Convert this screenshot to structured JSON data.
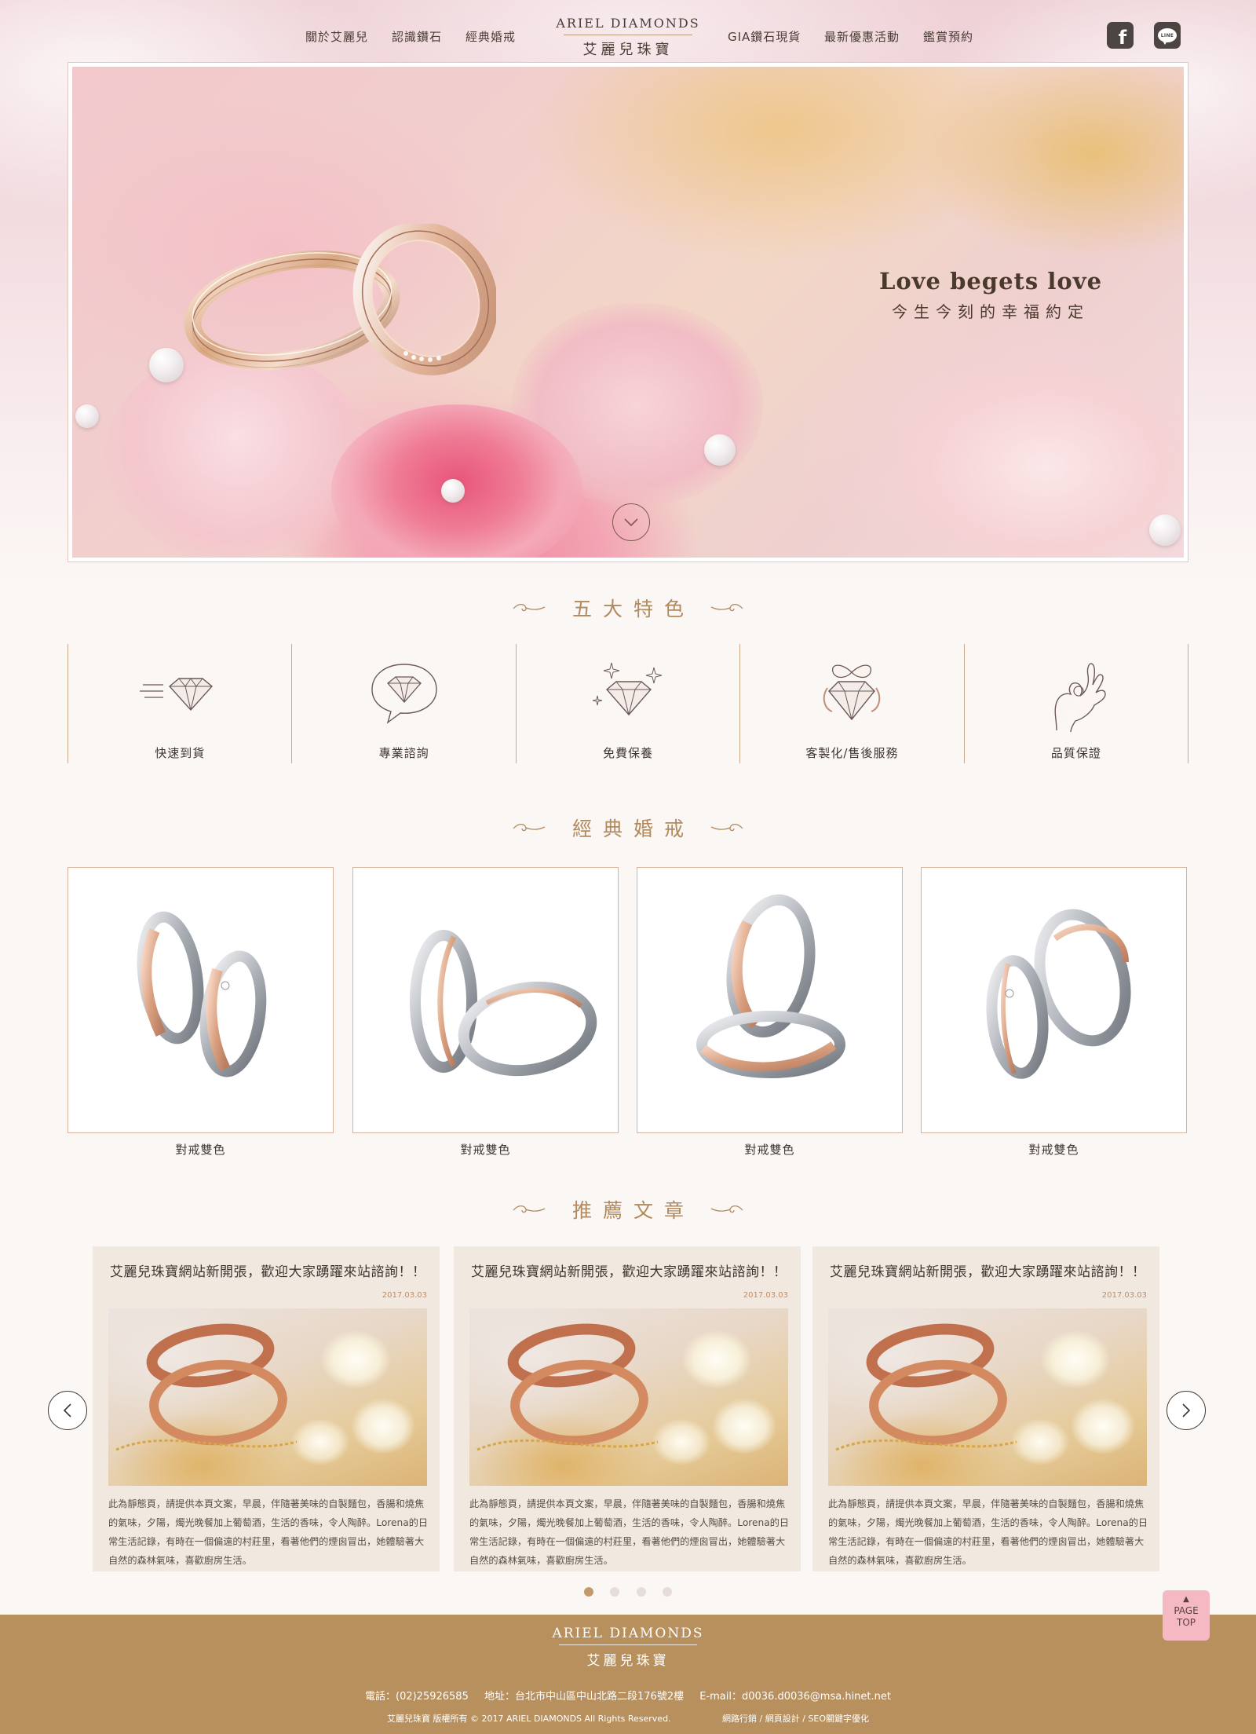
{
  "nav": {
    "left": [
      "關於艾麗兒",
      "認識鑽石",
      "經典婚戒"
    ],
    "right": [
      "GIA鑽石現貨",
      "最新優惠活動",
      "鑑賞預約"
    ],
    "logo_en": "ARIEL DIAMONDS",
    "logo_zh": "艾麗兒珠寶",
    "social": [
      {
        "name": "facebook",
        "icon": "facebook-icon",
        "glyph": "f"
      },
      {
        "name": "line",
        "icon": "line-icon",
        "glyph": "LINE"
      }
    ]
  },
  "hero": {
    "title": "Love begets love",
    "subtitle": "今生今刻的幸福約定"
  },
  "sections": {
    "features_title": "五大特色",
    "rings_title": "經典婚戒",
    "articles_title": "推薦文章"
  },
  "features": [
    {
      "label": "快速到貨",
      "icon": "fast-diamond-icon"
    },
    {
      "label": "專業諮詢",
      "icon": "diamond-speech-bubble-icon"
    },
    {
      "label": "免費保養",
      "icon": "sparkling-diamond-icon"
    },
    {
      "label": "客製化/售後服務",
      "icon": "diamond-gift-bow-icon"
    },
    {
      "label": "品質保證",
      "icon": "ok-hand-icon"
    }
  ],
  "rings": [
    {
      "label": "對戒雙色"
    },
    {
      "label": "對戒雙色"
    },
    {
      "label": "對戒雙色"
    },
    {
      "label": "對戒雙色"
    }
  ],
  "articles": [
    {
      "title": "艾麗兒珠寶網站新開張，歡迎大家踴躍來站諮詢！！",
      "date": "2017.03.03",
      "body": "此為靜態頁，請提供本頁文案，早晨，伴隨著美味的自製麵包，香腸和燒焦的氣味，夕陽，燭光晚餐加上葡萄酒，生活的香味，令人陶醉。Lorena的日常生活記錄，有時在一個偏遠的村莊里，看著他們的煙囪冒出，她體驗著大自然的森林氣味，喜歡廚房生活。"
    },
    {
      "title": "艾麗兒珠寶網站新開張，歡迎大家踴躍來站諮詢！！",
      "date": "2017.03.03",
      "body": "此為靜態頁，請提供本頁文案，早晨，伴隨著美味的自製麵包，香腸和燒焦的氣味，夕陽，燭光晚餐加上葡萄酒，生活的香味，令人陶醉。Lorena的日常生活記錄，有時在一個偏遠的村莊里，看著他們的煙囪冒出，她體驗著大自然的森林氣味，喜歡廚房生活。"
    },
    {
      "title": "艾麗兒珠寶網站新開張，歡迎大家踴躍來站諮詢！！",
      "date": "2017.03.03",
      "body": "此為靜態頁，請提供本頁文案，早晨，伴隨著美味的自製麵包，香腸和燒焦的氣味，夕陽，燭光晚餐加上葡萄酒，生活的香味，令人陶醉。Lorena的日常生活記錄，有時在一個偏遠的村莊里，看著他們的煙囪冒出，她體驗著大自然的森林氣味，喜歡廚房生活。"
    }
  ],
  "carousel": {
    "pages": 4,
    "active": 0
  },
  "page_top": {
    "arrow": "▲",
    "line1": "PAGE",
    "line2": "TOP"
  },
  "footer": {
    "logo_en": "ARIEL DIAMONDS",
    "logo_zh": "艾麗兒珠寶",
    "phone": "電話：(02)25926585",
    "address": "地址：台北市中山區中山北路二段176號2樓",
    "email": "E-mail：d0036.d0036@msa.hinet.net",
    "copyright": "艾麗兒珠寶 版權所有 © 2017 ARIEL DIAMONDS All Rights Reserved.",
    "credit": "網路行銷 / 網頁設計 / SEO關鍵字優化"
  },
  "colors": {
    "accent_gold": "#b08a5e",
    "footer_bg": "#b7905e",
    "card_bg": "#f1e8df",
    "page_top_bg": "#f4b9c3"
  }
}
